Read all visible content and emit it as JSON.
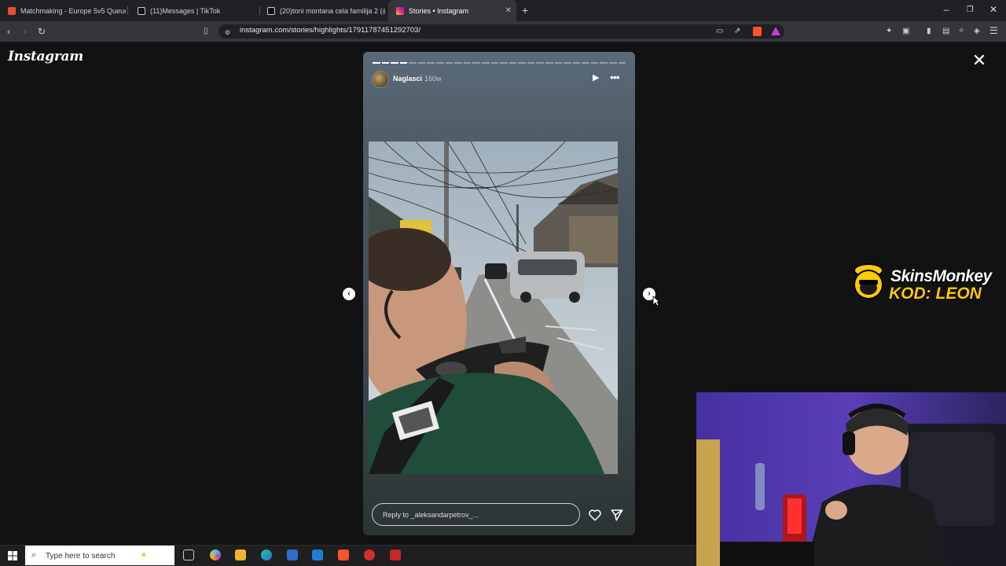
{
  "tabs": [
    {
      "title": "Matchmaking - Europe 5v5 Queue -",
      "active": false
    },
    {
      "title": "(11)Messages | TikTok",
      "active": false
    },
    {
      "title": "(20)toni montana cela familija 2 (@to",
      "active": false
    },
    {
      "title": "Stories • Instagram",
      "active": true
    }
  ],
  "address": {
    "url": "instagram.com/stories/highlights/17911787451292703/"
  },
  "instagram": {
    "logo": "Instagram"
  },
  "story": {
    "username": "Naglasci",
    "time_ago": "160w",
    "reply_placeholder": "Reply to _aleksandarpetrov_...",
    "progress_total": 28,
    "progress_done": 4
  },
  "overlay": {
    "brand_line1": "SkinsMonkey",
    "brand_line2": "KOD: LEON"
  },
  "taskbar": {
    "search_placeholder": "Type here to search"
  },
  "icons": {
    "back": "arrow-left-icon",
    "forward": "arrow-right-icon",
    "reload": "reload-icon",
    "bookmark": "bookmark-icon",
    "close": "close-icon",
    "play": "play-icon",
    "more": "more-icon",
    "heart": "heart-icon",
    "send": "send-icon"
  },
  "colors": {
    "brand_yellow": "#ffcc00",
    "chrome_bg": "#35363a",
    "page_bg": "#121212"
  }
}
